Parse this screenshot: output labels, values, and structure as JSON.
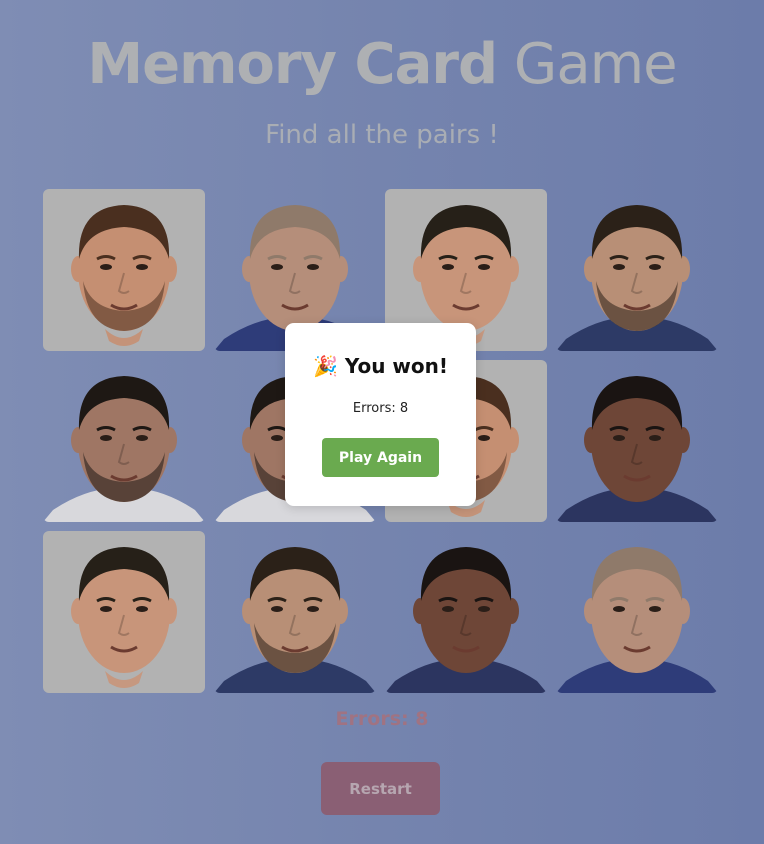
{
  "header": {
    "title_bold": "Memory Card",
    "title_light": "Game",
    "subtitle": "Find all the pairs !"
  },
  "board": {
    "cards": [
      {
        "player": "messi",
        "face": "#c58f72",
        "hair": "#4a2f1f",
        "beard": true,
        "shirt": null,
        "bg": true
      },
      {
        "player": "zidane",
        "face": "#b58e7a",
        "hair": "#8f7a6a",
        "beard": false,
        "shirt": "#2e3c79",
        "bg": false
      },
      {
        "player": "ronaldo",
        "face": "#c8957a",
        "hair": "#262018",
        "beard": false,
        "shirt": null,
        "bg": true
      },
      {
        "player": "neymar",
        "face": "#b88f76",
        "hair": "#2b2118",
        "beard": true,
        "shirt": "#2d3a66",
        "bg": false
      },
      {
        "player": "benzema",
        "face": "#9f7664",
        "hair": "#1e1814",
        "beard": true,
        "shirt": "#d8d8dc",
        "bg": false
      },
      {
        "player": "benzema",
        "face": "#9f7664",
        "hair": "#1e1814",
        "beard": true,
        "shirt": "#d8d8dc",
        "bg": false
      },
      {
        "player": "messi",
        "face": "#c58f72",
        "hair": "#4a2f1f",
        "beard": true,
        "shirt": null,
        "bg": true
      },
      {
        "player": "dembele",
        "face": "#6e4637",
        "hair": "#1a1412",
        "beard": false,
        "shirt": "#2c3560",
        "bg": false
      },
      {
        "player": "ronaldo",
        "face": "#c8957a",
        "hair": "#262018",
        "beard": false,
        "shirt": null,
        "bg": true
      },
      {
        "player": "neymar",
        "face": "#b88f76",
        "hair": "#2b2118",
        "beard": true,
        "shirt": "#2d3a66",
        "bg": false
      },
      {
        "player": "dembele",
        "face": "#6e4637",
        "hair": "#1a1412",
        "beard": false,
        "shirt": "#2c3560",
        "bg": false
      },
      {
        "player": "zidane",
        "face": "#b58e7a",
        "hair": "#8f7a6a",
        "beard": false,
        "shirt": "#2e3c79",
        "bg": false
      }
    ]
  },
  "status": {
    "errors_text": "Errors: 8",
    "restart_label": "Restart"
  },
  "modal": {
    "icon": "party-popper-icon",
    "emoji": "🎉",
    "title": "You won!",
    "errors_text": "Errors: 8",
    "play_again_label": "Play Again"
  },
  "colors": {
    "background": "#7584ae",
    "play_again": "#6aaa4f",
    "restart": "#8a5f74",
    "errors": "#a07382"
  }
}
